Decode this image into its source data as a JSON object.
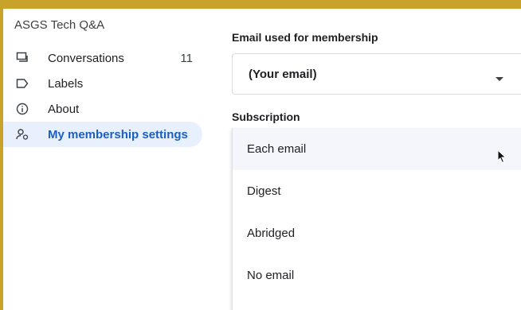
{
  "group": {
    "title": "ASGS Tech Q&A"
  },
  "nav": {
    "items": [
      {
        "label": "Conversations",
        "count": "11",
        "icon": "conversations-icon"
      },
      {
        "label": "Labels",
        "icon": "label-icon"
      },
      {
        "label": "About",
        "icon": "info-icon"
      },
      {
        "label": "My membership settings",
        "icon": "membership-icon",
        "active": true
      }
    ]
  },
  "settings": {
    "email_label": "Email used for membership",
    "email_value": "(Your email)",
    "subscription_label": "Subscription",
    "subscription_options": [
      "Each email",
      "Digest",
      "Abridged",
      "No email"
    ]
  },
  "colors": {
    "border": "#c9a22a",
    "active_bg": "#e8f0fe",
    "active_text": "#1a5fc4"
  }
}
